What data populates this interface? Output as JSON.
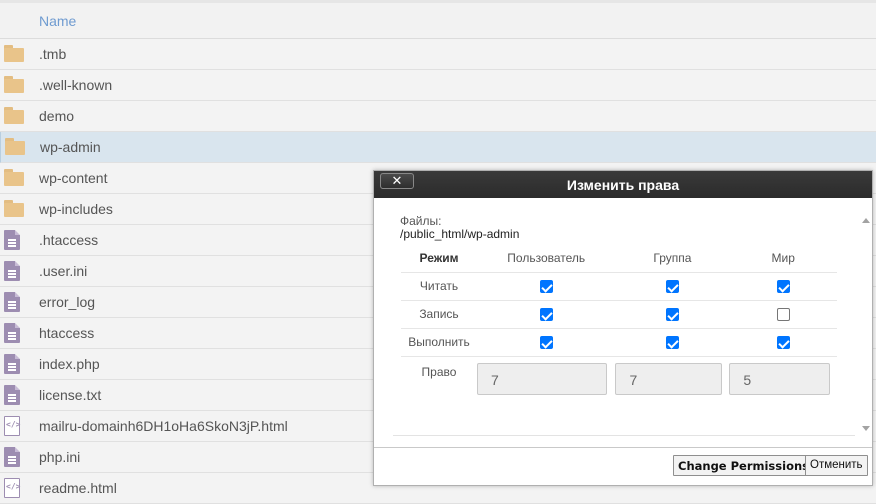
{
  "filelist": {
    "column_name": "Name",
    "rows": [
      {
        "name": ".tmb",
        "type": "folder",
        "icon": "folder-icon"
      },
      {
        "name": ".well-known",
        "type": "folder",
        "icon": "folder-icon"
      },
      {
        "name": "demo",
        "type": "folder",
        "icon": "folder-icon"
      },
      {
        "name": "wp-admin",
        "type": "folder",
        "icon": "folder-icon",
        "selected": true
      },
      {
        "name": "wp-content",
        "type": "folder",
        "icon": "folder-icon"
      },
      {
        "name": "wp-includes",
        "type": "folder",
        "icon": "folder-icon"
      },
      {
        "name": ".htaccess",
        "type": "file",
        "icon": "file-icon"
      },
      {
        "name": ".user.ini",
        "type": "file",
        "icon": "file-icon"
      },
      {
        "name": "error_log",
        "type": "file",
        "icon": "file-icon"
      },
      {
        "name": "htaccess",
        "type": "file",
        "icon": "file-icon"
      },
      {
        "name": "index.php",
        "type": "file",
        "icon": "file-icon"
      },
      {
        "name": "license.txt",
        "type": "file",
        "icon": "file-icon"
      },
      {
        "name": "mailru-domainh6DH1oHa6SkoN3jP.html",
        "type": "code",
        "icon": "code-file-icon"
      },
      {
        "name": "php.ini",
        "type": "file",
        "icon": "file-icon"
      },
      {
        "name": "readme.html",
        "type": "code",
        "icon": "code-file-icon"
      }
    ]
  },
  "dialog": {
    "title": "Изменить права",
    "close_label": "✕",
    "files_label": "Файлы:",
    "files_path": "/public_html/wp-admin",
    "mode_header": "Режим",
    "columns": [
      "Пользователь",
      "Группа",
      "Мир"
    ],
    "permissions": [
      {
        "label": "Читать",
        "values": [
          true,
          true,
          true
        ]
      },
      {
        "label": "Запись",
        "values": [
          true,
          true,
          false
        ]
      },
      {
        "label": "Выполнить",
        "values": [
          true,
          true,
          true
        ]
      }
    ],
    "octal_label": "Право",
    "octal_values": [
      "7",
      "7",
      "5"
    ],
    "buttons": {
      "change": "Change Permissions",
      "cancel": "Отменить"
    }
  }
}
